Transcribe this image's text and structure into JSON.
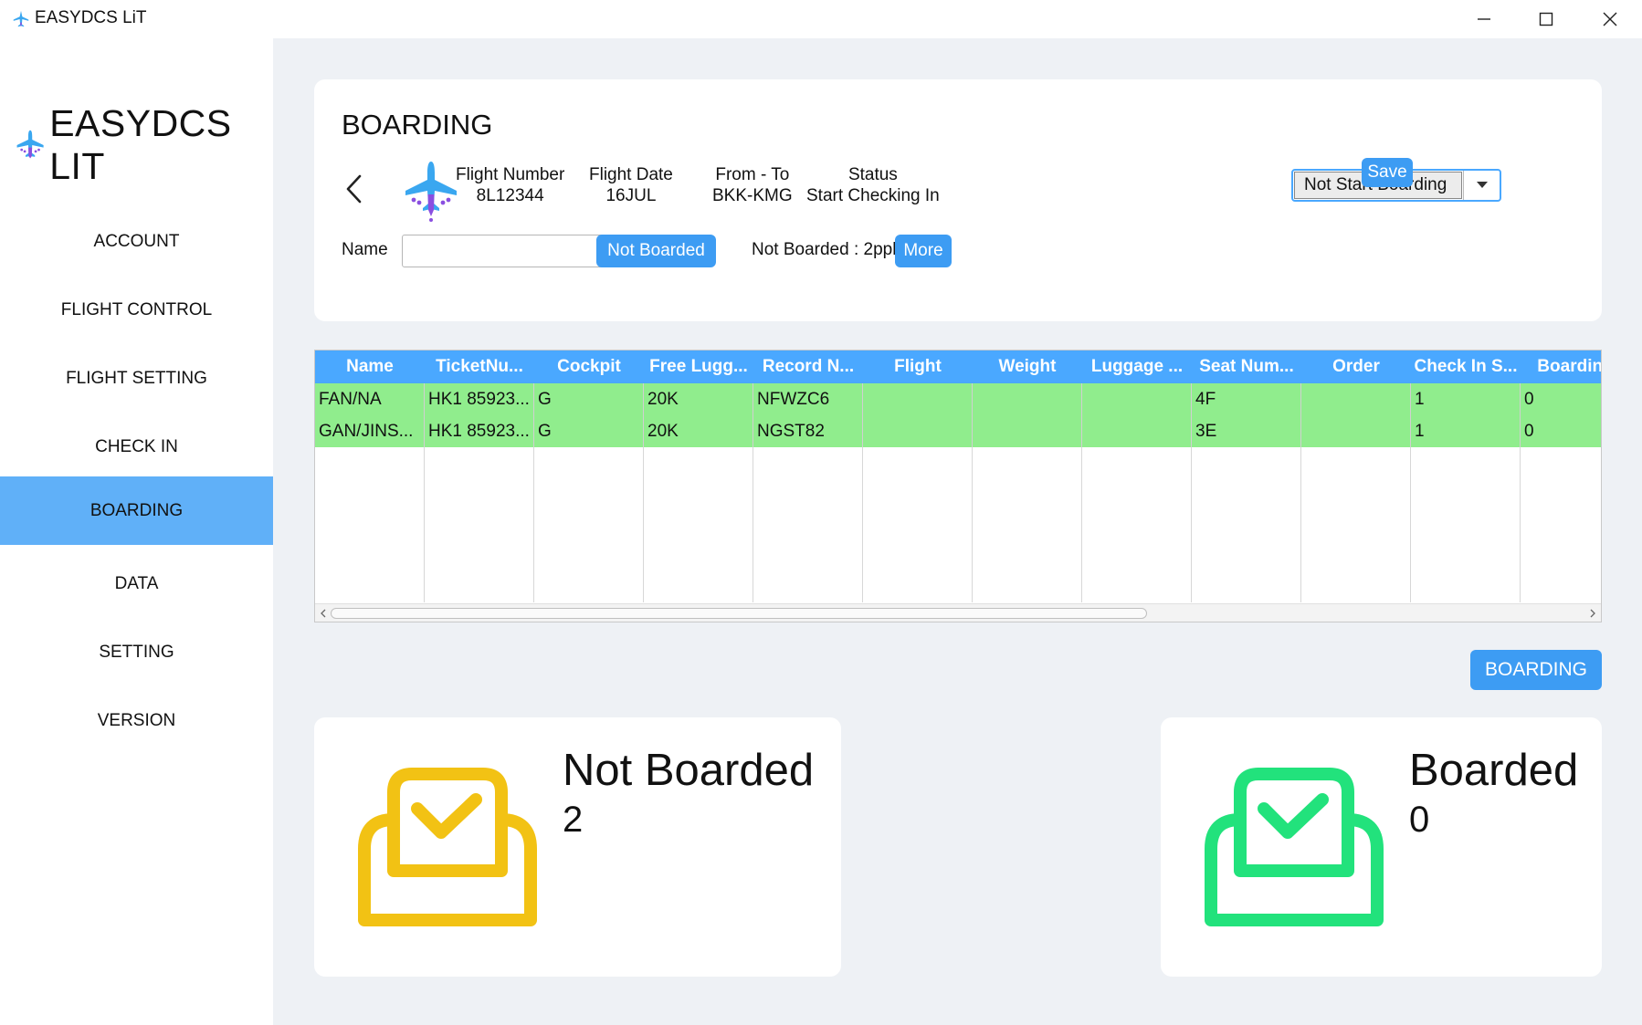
{
  "window": {
    "title": "EASYDCS LiT",
    "controls": [
      "minimize",
      "maximize",
      "close"
    ]
  },
  "sidebar": {
    "logo_text": "EASYDCS LIT",
    "items": [
      {
        "label": "ACCOUNT",
        "active": false
      },
      {
        "label": "FLIGHT CONTROL",
        "active": false
      },
      {
        "label": "FLIGHT SETTING",
        "active": false
      },
      {
        "label": "CHECK IN",
        "active": false
      },
      {
        "label": "BOARDING",
        "active": true
      },
      {
        "label": "DATA",
        "active": false
      },
      {
        "label": "SETTING",
        "active": false
      },
      {
        "label": "VERSION",
        "active": false
      }
    ]
  },
  "header": {
    "title": "BOARDING",
    "flight_number_label": "Flight Number",
    "flight_number": "8L12344",
    "flight_date_label": "Flight Date",
    "flight_date": "16JUL",
    "from_to_label": "From - To",
    "from_to": "BKK-KMG",
    "status_label": "Status",
    "status": "Start Checking In",
    "boarding_status_select": "Not Start Boarding",
    "save_label": "Save"
  },
  "filter": {
    "name_label": "Name",
    "name_value": "",
    "not_boarded_button": "Not Boarded",
    "not_boarded_count": "Not Boarded : 2ppl",
    "more_button": "More"
  },
  "table": {
    "columns": [
      "Name",
      "TicketNu...",
      "Cockpit",
      "Free Lugg...",
      "Record N...",
      "Flight",
      "Weight",
      "Luggage ...",
      "Seat Num...",
      "Order",
      "Check In S...",
      "Boarding"
    ],
    "rows": [
      [
        "FAN/NA",
        "HK1 85923...",
        "G",
        "20K",
        "NFWZC6",
        "",
        "",
        "",
        "4F",
        "",
        "1",
        "0"
      ],
      [
        "GAN/JINS...",
        "HK1 85923...",
        "G",
        "20K",
        "NGST82",
        "",
        "",
        "",
        "3E",
        "",
        "1",
        "0"
      ]
    ],
    "row_color": "#90ed8d",
    "header_color": "#4aa8ff"
  },
  "actions": {
    "boarding_button": "BOARDING"
  },
  "stats": {
    "not_boarded_title": "Not Boarded",
    "not_boarded_value": "2",
    "not_boarded_color": "#f2c214",
    "boarded_title": "Boarded",
    "boarded_value": "0",
    "boarded_color": "#22e27c"
  },
  "colors": {
    "accent": "#3d9cf3",
    "sidebar_active": "#60b0f8",
    "main_bg": "#eef1f5"
  }
}
